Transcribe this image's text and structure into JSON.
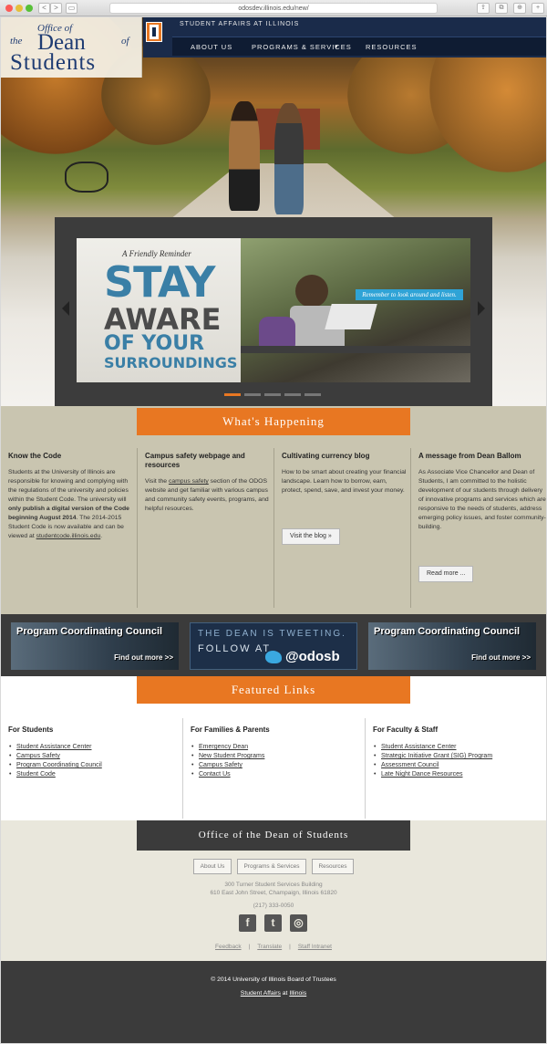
{
  "browser": {
    "url": "odosdev.illinois.edu/new/",
    "back": "<",
    "forward": ">",
    "sidebar": "▭",
    "share": "⇪",
    "tabs": "⧉",
    "downloads": "⊕",
    "add_tab": "+"
  },
  "logo": {
    "office": "Office of",
    "the": "the",
    "dean": "Dean",
    "of": "of",
    "students": "Students"
  },
  "header": {
    "unit": "STUDENT AFFAIRS AT ILLINOIS",
    "nav": [
      "ABOUT US",
      "PROGRAMS & SERVICES",
      "RESOURCES"
    ],
    "dropdown_icon": "▾"
  },
  "slide": {
    "reminder": "A Friendly Reminder",
    "stay": "STAY",
    "aware": "AWARE",
    "of_your": "OF YOUR",
    "surroundings": "SURROUNDINGS",
    "tagline": "Remember to look around and listen.",
    "active_dot": 0
  },
  "whats_happening": {
    "title": "What's Happening",
    "columns": [
      {
        "heading": "Know the Code",
        "body_pre": "Students at the University of Illinois are responsible for knowing and complying with the regulations of the university and policies within the Student Code. The university will ",
        "body_bold": "only publish a digital version of the Code beginning August 2014",
        "body_mid": ". The 2014-2015 Student Code is now available and can be viewed at ",
        "body_link": "studentcode.illinois.edu",
        "body_end": "."
      },
      {
        "heading": "Campus safety webpage and resources",
        "body_pre": "Visit the ",
        "body_link": "campus safety",
        "body_end": " section of the ODOS website and get familiar with various campus and community safety events, programs, and helpful resources."
      },
      {
        "heading": "Cultivating currency blog",
        "body": "How to be smart about creating your financial landscape. Learn how to borrow, earn, protect, spend, save, and invest your money.",
        "button": "Visit the blog »"
      },
      {
        "heading": "A message from Dean Ballom",
        "body": "As Associate Vice Chancellor and Dean of Students, I am committed to the holistic development of our students through delivery of innovative programs and services which are responsive to the needs of students, address emerging policy issues, and foster community-building.",
        "button": "Read more ..."
      }
    ]
  },
  "promos": {
    "pcc_title": "Program Coordinating Council",
    "pcc_link": "Find out more >>",
    "tweet_line1": "THE DEAN IS TWEETING.",
    "tweet_line2": "FOLLOW AT",
    "tweet_handle": "@odosb"
  },
  "featured_links": {
    "title": "Featured Links",
    "columns": [
      {
        "heading": "For Students",
        "links": [
          "Student Assistance Center",
          "Campus Safety",
          "Program Coordinating Council",
          "Student Code"
        ]
      },
      {
        "heading": "For Families & Parents",
        "links": [
          "Emergency Dean",
          "New Student Programs",
          "Campus Safety",
          "Contact Us"
        ]
      },
      {
        "heading": "For Faculty & Staff",
        "links": [
          "Student Assistance Center",
          "Strategic Initiative Grant (SIG) Program",
          "Assessment Council",
          "Late Night Dance Resources"
        ]
      }
    ]
  },
  "footer": {
    "title": "Office of the Dean of Students",
    "buttons": [
      "About Us",
      "Programs & Services",
      "Resources"
    ],
    "address1": "300 Turner Student Services Building",
    "address2": "610 East John Street, Champaign, Illinois 61820",
    "phone": "(217) 333-0050",
    "social": [
      {
        "label": "f",
        "icon": "facebook-icon"
      },
      {
        "label": "t",
        "icon": "twitter-icon"
      },
      {
        "label": "◎",
        "icon": "instagram-icon"
      }
    ],
    "links": [
      "Feedback",
      "Translate",
      "Staff Intranet"
    ],
    "copyright": "© 2014 University of Illinois Board of Trustees",
    "sa_link": "Student Affairs",
    "at": "at",
    "illinois_link": "Illinois"
  },
  "colors": {
    "orange": "#e87722",
    "navy": "#13294b",
    "tan": "#c9c5b0",
    "dark": "#3b3b3b"
  }
}
